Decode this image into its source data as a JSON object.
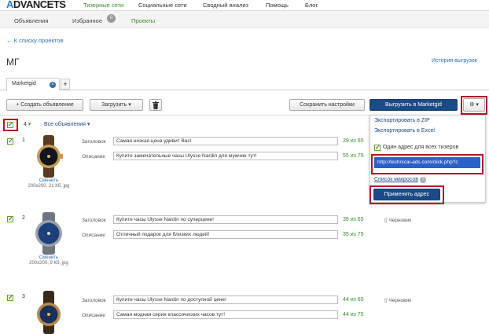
{
  "brand": {
    "logo_a": "A",
    "logo_rest": "DVANCETS"
  },
  "top_nav": [
    "Тизерные сети",
    "Социальные сети",
    "Сводный анализ",
    "Помощь",
    "Блог"
  ],
  "sub_nav": {
    "items": [
      "Объявления",
      "Избранное",
      "Проекты"
    ],
    "badge": "0"
  },
  "back_link": "← К списку проектов",
  "page_title": "МГ",
  "history_link": "История выгрузок",
  "tab": {
    "label": "Marketgid",
    "close": "×",
    "add": "+"
  },
  "toolbar": {
    "create": "+ Создать объявление",
    "load": "Загрузить ▾",
    "save_settings": "Сохранить настройки",
    "export": "Выгрузить в Marketgid",
    "gear": "⚙ ▾"
  },
  "list_header": {
    "count": "4",
    "filter": "Все объявления ▾"
  },
  "dropdown": {
    "zip": "Экспортировать в ZIP",
    "excel": "Экспортировать в Excel",
    "one_address": "Один адрес для всех тизеров",
    "url": "http://technical-ads.com/click.php?c",
    "macros": "Список макросов",
    "apply": "Применить адрес"
  },
  "field_labels": {
    "title": "Заголовок",
    "desc": "Описание"
  },
  "ads": [
    {
      "num": "1",
      "title": "Самая низкая цена удивит Вас!",
      "title_count": "29 из 65",
      "desc": "Купите замечательные часы Ulysse Nardin для мужчин тут!",
      "desc_count": "55 из 75",
      "thumb_link": "Сменить",
      "thumb_info": "200x200, 21 Кб, jpg",
      "draft": ""
    },
    {
      "num": "2",
      "title": "Купите часы Ulysse Nardin по суперцене!",
      "title_count": "39 из 65",
      "desc": "Отличный подарок для близких людей!",
      "desc_count": "35 из 75",
      "thumb_link": "Сменить",
      "thumb_info": "200x200, 9 Кб, jpg",
      "draft": "Черновик"
    },
    {
      "num": "3",
      "title": "Купите часы Ulysse Nardin по доступной цене!",
      "title_count": "44 из 65",
      "desc": "Самая модная серия классических часов тут!",
      "desc_count": "44 из 75",
      "thumb_link": "",
      "thumb_info": "",
      "draft": "Черновик"
    }
  ],
  "colors": {
    "accent_green": "#3b8a2a",
    "link_blue": "#2a6fb0",
    "primary": "#1b4a86",
    "highlight": "#b0182a"
  }
}
